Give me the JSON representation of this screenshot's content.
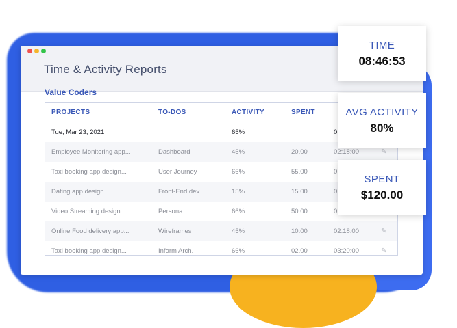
{
  "window": {
    "title": "Time & Activity Reports",
    "company": "Value Coders"
  },
  "table": {
    "headers": [
      "PROJECTS",
      "TO-DOS",
      "ACTIVITY",
      "SPENT",
      ""
    ],
    "date_row": {
      "date": "Tue, Mar 23, 2021",
      "activity": "65%",
      "time_partial": "0"
    },
    "rows": [
      {
        "project": "Employee Monitoring app...",
        "todo": "Dashboard",
        "activity": "45%",
        "spent": "20.00",
        "time": "02:18:00"
      },
      {
        "project": "Taxi booking app design...",
        "todo": "User Journey",
        "activity": "66%",
        "spent": "55.00",
        "time": "0"
      },
      {
        "project": "Dating app design...",
        "todo": "Front-End dev",
        "activity": "15%",
        "spent": "15.00",
        "time": "0"
      },
      {
        "project": "Video Streaming design...",
        "todo": "Persona",
        "activity": "66%",
        "spent": "50.00",
        "time": "0"
      },
      {
        "project": "Online Food delivery app...",
        "todo": "Wireframes",
        "activity": "45%",
        "spent": "10.00",
        "time": "02:18:00"
      },
      {
        "project": "Taxi booking app design...",
        "todo": "Inform Arch.",
        "activity": "66%",
        "spent": "02.00",
        "time": "03:20:00"
      }
    ]
  },
  "cards": {
    "time": {
      "label": "TIME",
      "value": "08:46:53"
    },
    "avg_activity": {
      "label": "AVG ACTIVITY",
      "value": "80%"
    },
    "spent": {
      "label": "SPENT",
      "value": "$120.00"
    }
  },
  "icons": {
    "edit": "pencil-icon"
  },
  "colors": {
    "accent": "#3a58b7",
    "background_blue": "#2f5fe3",
    "background_yellow": "#f7b21f"
  }
}
